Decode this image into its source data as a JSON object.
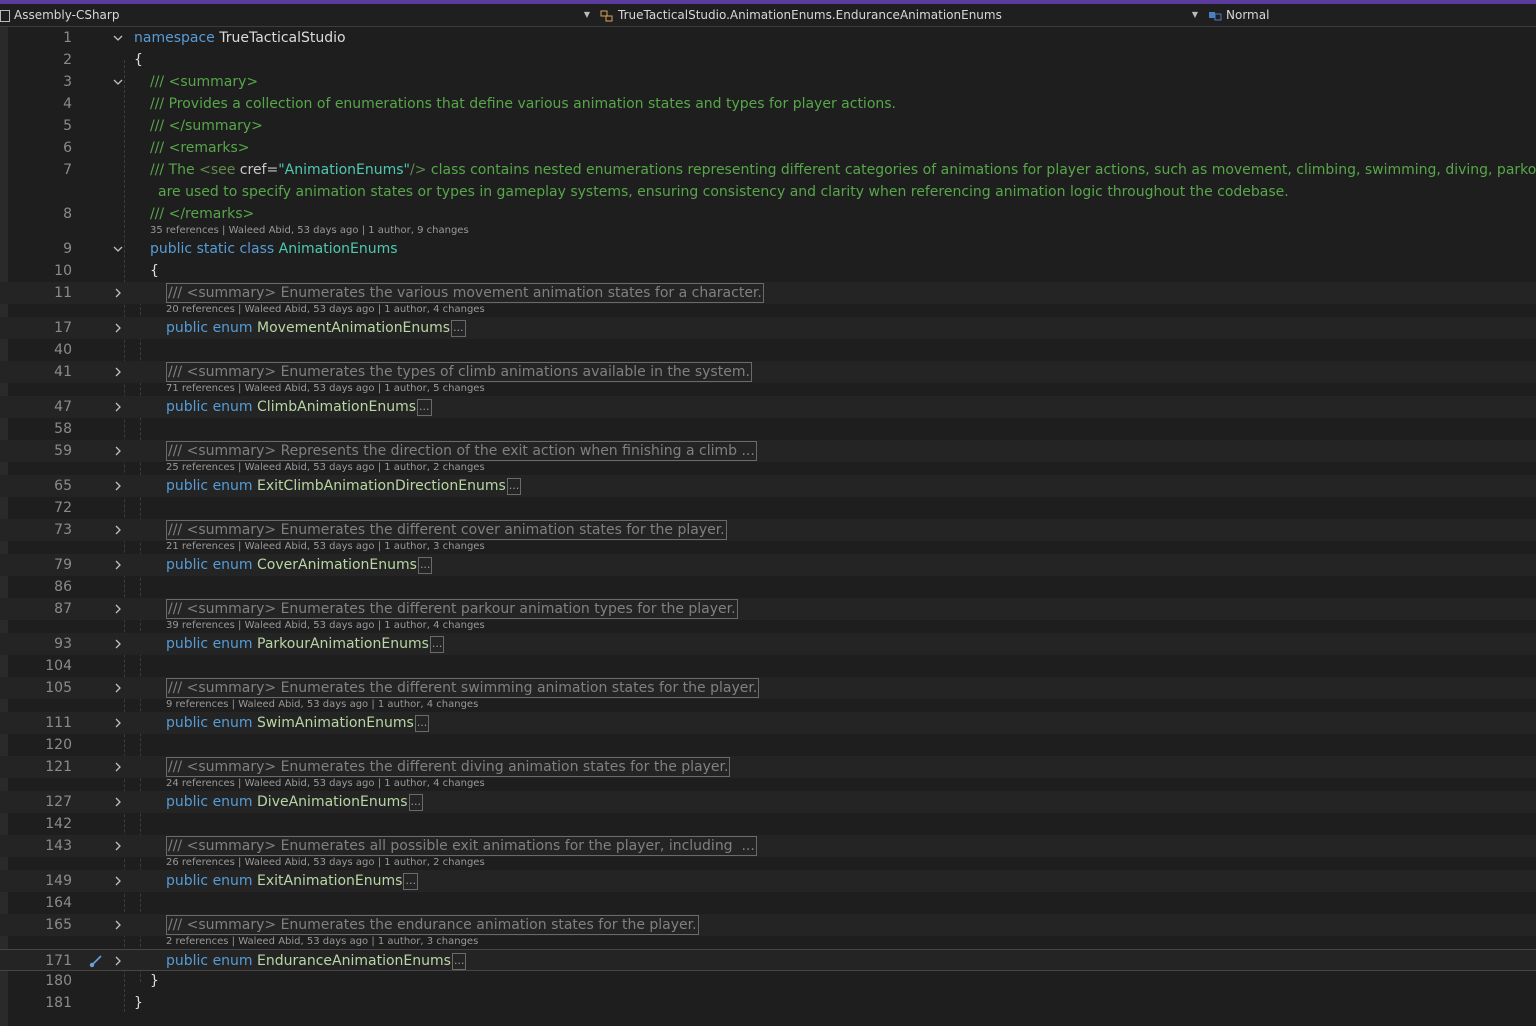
{
  "navbar": {
    "project": "Assembly-CSharp",
    "scope": "TrueTacticalStudio.AnimationEnums.EnduranceAnimationEnums",
    "member": "Normal",
    "icons": [
      "project-icon",
      "class-icon",
      "member-icon"
    ]
  },
  "colors": {
    "keyword": "#569cd6",
    "type": "#4ec9b0",
    "enum": "#b8d7a3",
    "comment": "#57a64a",
    "background": "#1e1e1e",
    "accent": "#5c3b9e"
  },
  "code": {
    "l1": {
      "num": "1",
      "kw": "namespace",
      "name": "TrueTacticalStudio"
    },
    "l2": {
      "num": "2",
      "text": "{"
    },
    "l3": {
      "num": "3",
      "text": "/// <summary>"
    },
    "l4": {
      "num": "4",
      "text": "/// Provides a collection of enumerations that define various animation states and types for player actions."
    },
    "l5": {
      "num": "5",
      "text": "/// </summary>"
    },
    "l6": {
      "num": "6",
      "text": "/// <remarks>"
    },
    "l7": {
      "num": "7",
      "pre": "/// The ",
      "tag": "<see ",
      "attr": "cref=",
      "val": "\"AnimationEnums\"",
      "close": "/>",
      "rest": " class contains nested enumerations representing different categories of animations for player actions, such as movement, climbing, swimming, diving, parkour, a"
    },
    "l7b": {
      "text": "are used to specify animation states or types in gameplay systems, ensuring consistency and clarity when referencing animation logic throughout the codebase."
    },
    "l8": {
      "num": "8",
      "text": "/// </remarks>"
    },
    "lens_class": "35 references | Waleed Abid, 53 days ago | 1 author, 9 changes",
    "l9": {
      "num": "9",
      "kw": "public static class",
      "name": "AnimationEnums"
    },
    "l10": {
      "num": "10",
      "text": "{"
    },
    "enums": [
      {
        "sum_line": "11",
        "summary": "/// <summary> Enumerates the various movement animation states for a character.",
        "lens": "20 references | Waleed Abid, 53 days ago | 1 author, 4 changes",
        "decl_line": "17",
        "kw": "public enum",
        "name": "MovementAnimationEnums",
        "blank_line": "40"
      },
      {
        "sum_line": "41",
        "summary": "/// <summary> Enumerates the types of climb animations available in the system.",
        "lens": "71 references | Waleed Abid, 53 days ago | 1 author, 5 changes",
        "decl_line": "47",
        "kw": "public enum",
        "name": "ClimbAnimationEnums",
        "blank_line": "58"
      },
      {
        "sum_line": "59",
        "summary": "/// <summary> Represents the direction of the exit action when finishing a climb ...",
        "lens": "25 references | Waleed Abid, 53 days ago | 1 author, 2 changes",
        "decl_line": "65",
        "kw": "public enum",
        "name": "ExitClimbAnimationDirectionEnums",
        "blank_line": "72"
      },
      {
        "sum_line": "73",
        "summary": "/// <summary> Enumerates the different cover animation states for the player.",
        "lens": "21 references | Waleed Abid, 53 days ago | 1 author, 3 changes",
        "decl_line": "79",
        "kw": "public enum",
        "name": "CoverAnimationEnums",
        "blank_line": "86"
      },
      {
        "sum_line": "87",
        "summary": "/// <summary> Enumerates the different parkour animation types for the player.",
        "lens": "39 references | Waleed Abid, 53 days ago | 1 author, 4 changes",
        "decl_line": "93",
        "kw": "public enum",
        "name": "ParkourAnimationEnums",
        "blank_line": "104"
      },
      {
        "sum_line": "105",
        "summary": "/// <summary> Enumerates the different swimming animation states for the player.",
        "lens": "9 references | Waleed Abid, 53 days ago | 1 author, 4 changes",
        "decl_line": "111",
        "kw": "public enum",
        "name": "SwimAnimationEnums",
        "blank_line": "120"
      },
      {
        "sum_line": "121",
        "summary": "/// <summary> Enumerates the different diving animation states for the player.",
        "lens": "24 references | Waleed Abid, 53 days ago | 1 author, 4 changes",
        "decl_line": "127",
        "kw": "public enum",
        "name": "DiveAnimationEnums",
        "blank_line": "142"
      },
      {
        "sum_line": "143",
        "summary": "/// <summary> Enumerates all possible exit animations for the player, including  ...",
        "lens": "26 references | Waleed Abid, 53 days ago | 1 author, 2 changes",
        "decl_line": "149",
        "kw": "public enum",
        "name": "ExitAnimationEnums",
        "blank_line": "164"
      },
      {
        "sum_line": "165",
        "summary": "/// <summary> Enumerates the endurance animation states for the player.",
        "lens": "2 references | Waleed Abid, 53 days ago | 1 author, 3 changes",
        "decl_line": "171",
        "kw": "public enum",
        "name": "EnduranceAnimationEnums",
        "blank_line": ""
      }
    ],
    "l180": {
      "num": "180",
      "text": "}"
    },
    "l181": {
      "num": "181",
      "text": "}"
    },
    "ellipsis": "..."
  }
}
